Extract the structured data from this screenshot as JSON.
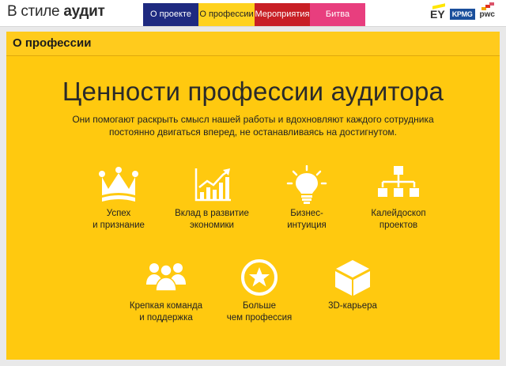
{
  "header": {
    "logo_prefix": "В стиле",
    "logo_word": "аудит",
    "tabs": [
      {
        "label": "О проекте"
      },
      {
        "label": "О профессии"
      },
      {
        "label": "Мероприятия"
      },
      {
        "label": "Битва"
      }
    ],
    "partners": [
      "EY",
      "KPMG",
      "pwc"
    ]
  },
  "panel": {
    "title": "О профессии",
    "headline": "Ценности профессии аудитора",
    "subtitle": "Они помогают раскрыть смысл нашей работы и вдохновляют каждого сотрудника постоянно двигаться вперед, не останавливаясь на достигнутом.",
    "items": [
      {
        "label_line1": "Успех",
        "label_line2": "и признание",
        "icon": "crown-icon"
      },
      {
        "label_line1": "Вклад в развитие",
        "label_line2": "экономики",
        "icon": "growth-chart-icon"
      },
      {
        "label_line1": "Бизнес-",
        "label_line2": "интуиция",
        "icon": "lightbulb-icon"
      },
      {
        "label_line1": "Калейдоскоп",
        "label_line2": "проектов",
        "icon": "hierarchy-icon"
      },
      {
        "label_line1": "Крепкая команда",
        "label_line2": "и поддержка",
        "icon": "team-icon"
      },
      {
        "label_line1": "Больше",
        "label_line2": "чем профессия",
        "icon": "star-circle-icon"
      },
      {
        "label_line1": "3D-карьера",
        "label_line2": "",
        "icon": "cube-icon"
      }
    ]
  },
  "colors": {
    "panel_yellow": "#ffc90f",
    "tab_blue": "#1e2a80",
    "tab_yellow": "#ffd21f",
    "tab_red": "#c81f25",
    "tab_pink": "#e83e7e"
  }
}
